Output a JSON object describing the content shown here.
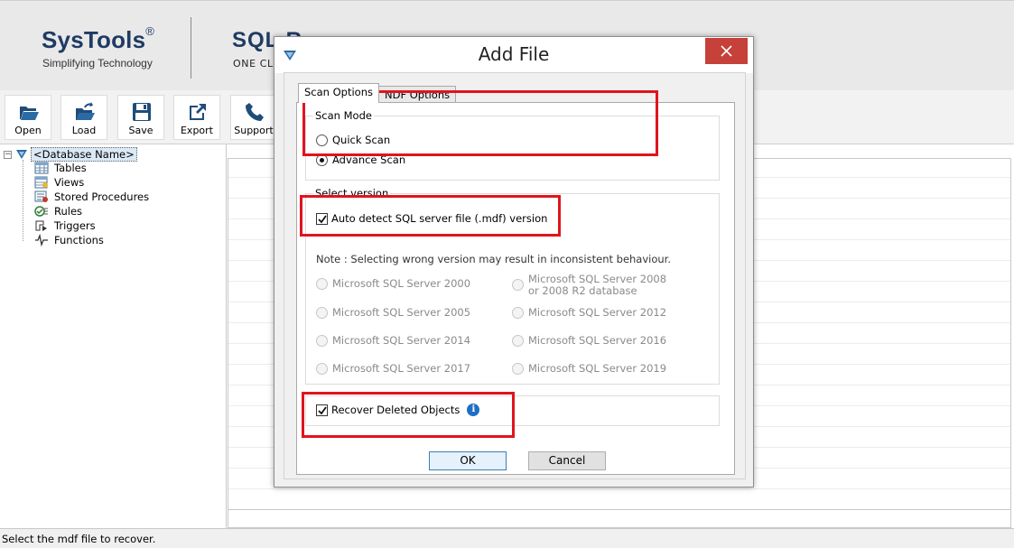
{
  "header": {
    "brand_name": "SysTools",
    "brand_reg": "®",
    "brand_tagline": "Simplifying Technology",
    "product_name": "SQL R",
    "product_sub": "ONE CL"
  },
  "toolbar": {
    "buttons": [
      {
        "label": "Open",
        "icon": "folder-open-icon"
      },
      {
        "label": "Load",
        "icon": "folder-load-icon"
      },
      {
        "label": "Save",
        "icon": "floppy-disk-icon"
      },
      {
        "label": "Export",
        "icon": "export-arrow-icon"
      },
      {
        "label": "Support",
        "icon": "phone-icon"
      }
    ]
  },
  "tree": {
    "root_label": "<Database Name>",
    "items": [
      {
        "label": "Tables",
        "icon": "table-icon"
      },
      {
        "label": "Views",
        "icon": "view-icon"
      },
      {
        "label": "Stored Procedures",
        "icon": "stored-procedure-icon"
      },
      {
        "label": "Rules",
        "icon": "rules-icon"
      },
      {
        "label": "Triggers",
        "icon": "trigger-icon"
      },
      {
        "label": "Functions",
        "icon": "function-icon"
      }
    ]
  },
  "status": {
    "text": "Select the mdf file to recover."
  },
  "dialog": {
    "title": "Add File",
    "tabs": {
      "scan_options": "Scan Options",
      "ndf_options": "NDF Options"
    },
    "scan_mode": {
      "title": "Scan Mode",
      "quick_scan": "Quick Scan",
      "advance_scan": "Advance Scan",
      "selected": "Advance Scan"
    },
    "select_version": {
      "title": "Select version",
      "auto_detect_label": "Auto detect SQL server file (.mdf) version",
      "auto_detect_checked": true,
      "note": "Note : Selecting wrong version may result in inconsistent behaviour.",
      "versions": [
        "Microsoft SQL Server 2000",
        "Microsoft SQL Server 2008\nor 2008 R2 database",
        "Microsoft SQL Server 2005",
        "Microsoft SQL Server 2012",
        "Microsoft SQL Server 2014",
        "Microsoft SQL Server 2016",
        "Microsoft SQL Server 2017",
        "Microsoft SQL Server 2019"
      ],
      "version_2008_line1": "Microsoft SQL Server 2008",
      "version_2008_line2": "or 2008 R2 database"
    },
    "recover_deleted": {
      "label": "Recover Deleted Objects",
      "checked": true
    },
    "buttons": {
      "ok": "OK",
      "cancel": "Cancel"
    }
  },
  "colors": {
    "brand_navy": "#1f3b63",
    "highlight_red": "#e0141e",
    "close_red": "#c7413b",
    "info_blue": "#1d6fc4"
  }
}
